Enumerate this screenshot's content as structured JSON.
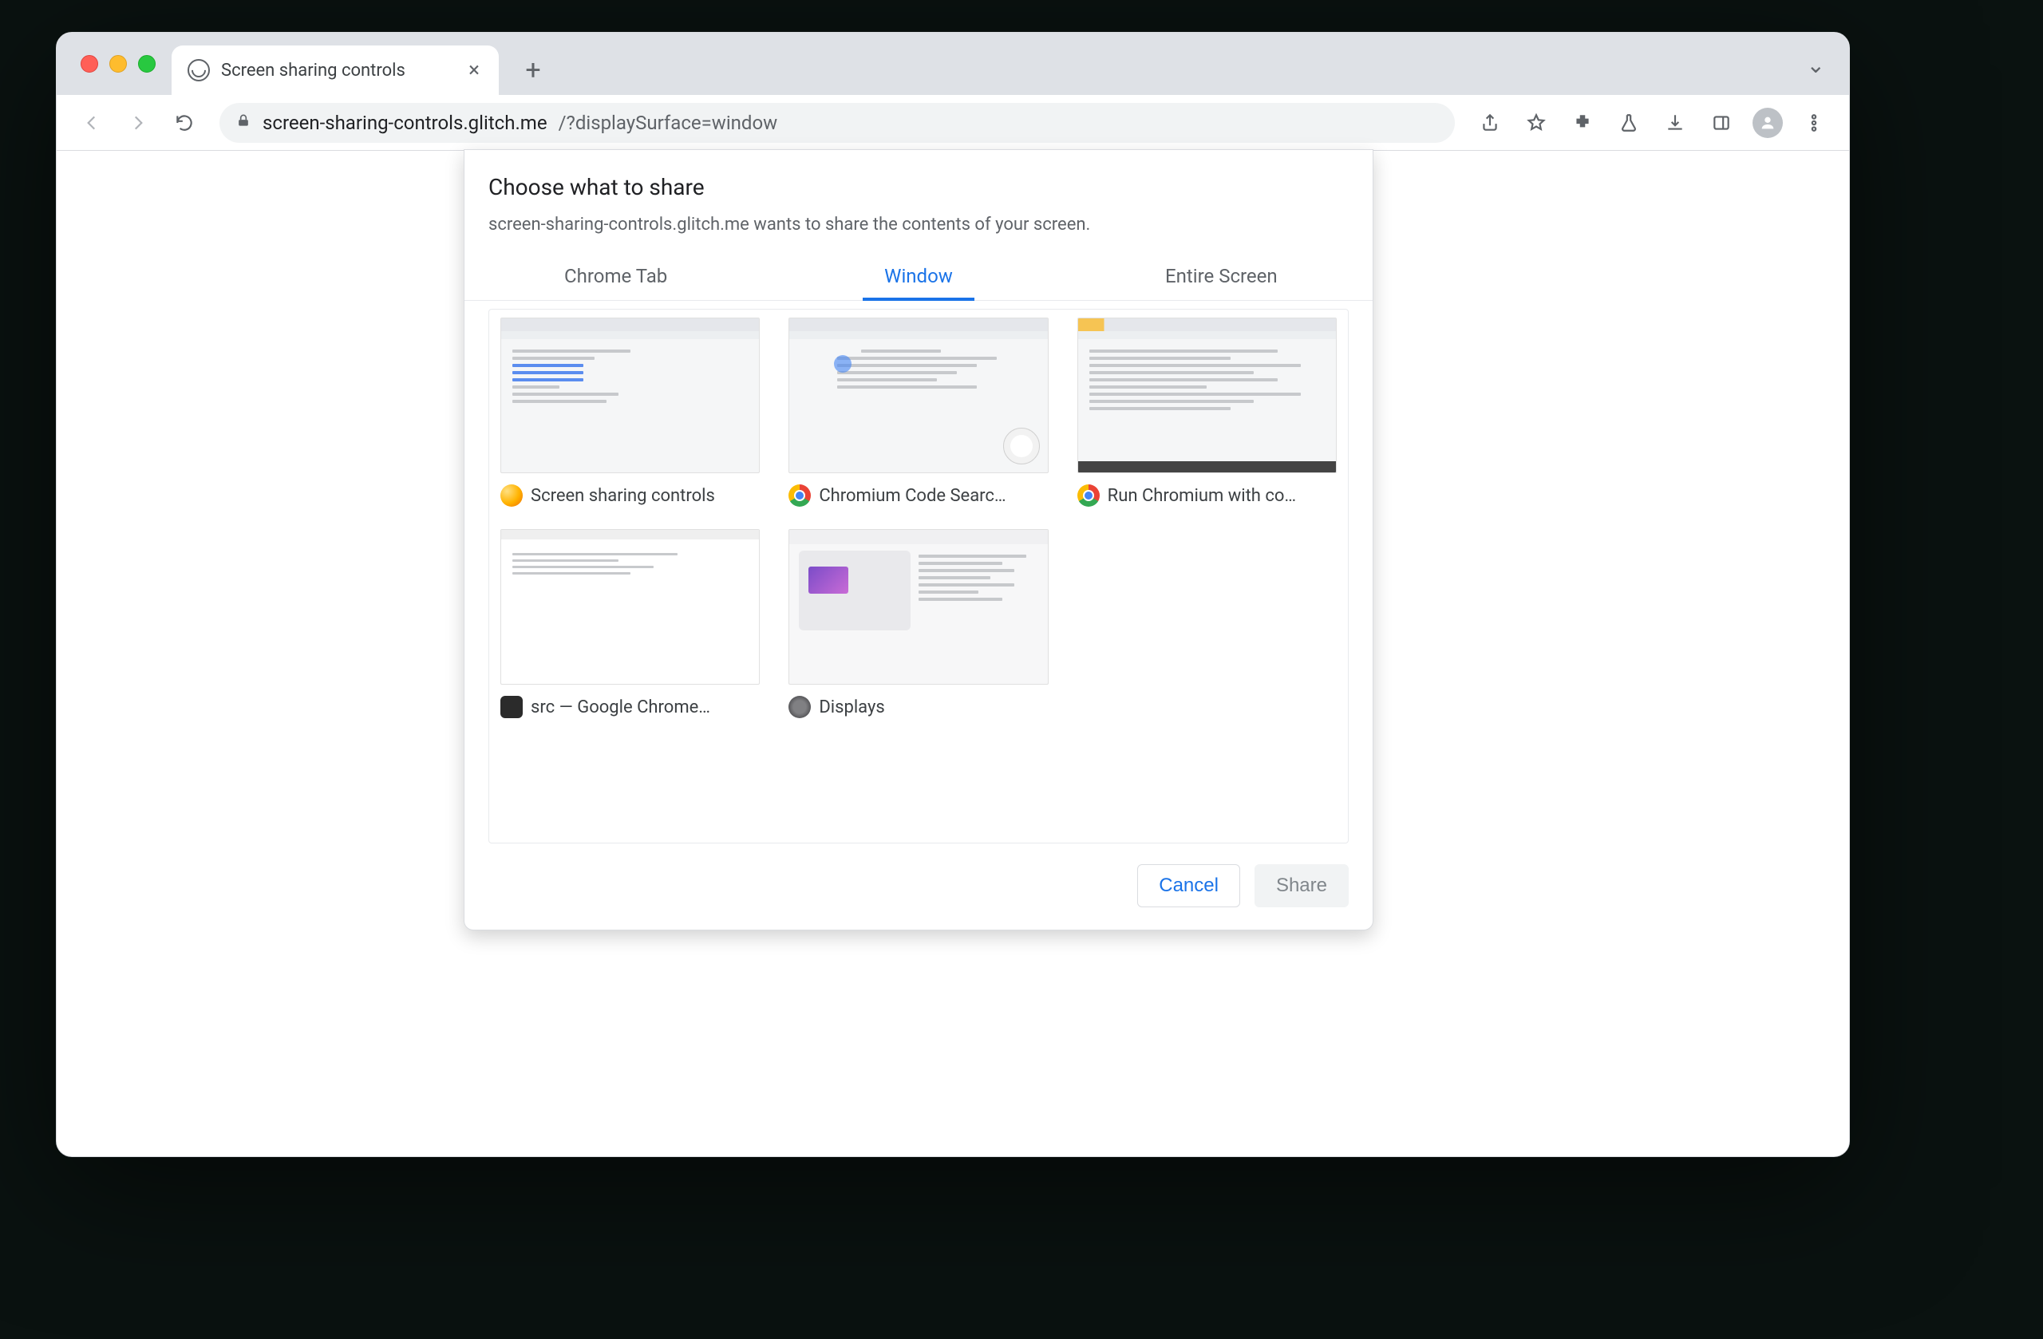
{
  "tab": {
    "title": "Screen sharing controls"
  },
  "omnibox": {
    "host": "screen-sharing-controls.glitch.me",
    "path": "/?displaySurface=window"
  },
  "dialog": {
    "title": "Choose what to share",
    "subtitle": "screen-sharing-controls.glitch.me wants to share the contents of your screen.",
    "tabs": {
      "chrome_tab": "Chrome Tab",
      "window": "Window",
      "entire_screen": "Entire Screen"
    },
    "active_tab": "window",
    "windows": [
      {
        "label": "Screen sharing controls",
        "icon": "canary"
      },
      {
        "label": "Chromium Code Searc…",
        "icon": "chrome"
      },
      {
        "label": "Run Chromium with co…",
        "icon": "chrome"
      },
      {
        "label": "src — Google Chrome…",
        "icon": "term"
      },
      {
        "label": "Displays",
        "icon": "pref"
      }
    ],
    "buttons": {
      "cancel": "Cancel",
      "share": "Share"
    }
  }
}
